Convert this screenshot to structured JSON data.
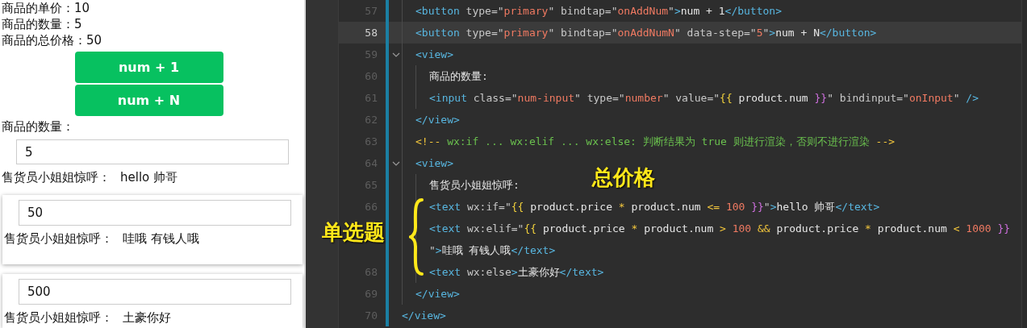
{
  "preview": {
    "info": [
      "商品的单价：10",
      "商品的数量：5",
      "商品的总价格：50"
    ],
    "buttons": [
      "num + 1",
      "num + N"
    ],
    "quantity_label": "商品的数量：",
    "quantity_input": {
      "value": "5"
    },
    "greeting": {
      "label": "售货员小姐姐惊呼：",
      "message": "hello 帅哥"
    },
    "cards": [
      {
        "input": {
          "value": "50"
        },
        "greeting": {
          "label": "售货员小姐姐惊呼：",
          "message": "哇哦 有钱人哦"
        }
      },
      {
        "input": {
          "value": "500"
        },
        "greeting": {
          "label": "售货员小姐姐惊呼：",
          "message": "土豪你好"
        }
      }
    ]
  },
  "editor": {
    "lines": [
      {
        "children": [
          {
            "number": "57",
            "fold": false,
            "current": false,
            "tokens": [
              {
                "kind": "tag",
                "text": "<button"
              },
              {
                "kind": "attr",
                "text": " type=\""
              },
              {
                "kind": "str",
                "text": "primary"
              },
              {
                "kind": "attr",
                "text": "\" bindtap=\""
              },
              {
                "kind": "str",
                "text": "onAddNum"
              },
              {
                "kind": "attr",
                "text": "\""
              },
              {
                "kind": "tag",
                "text": ">"
              },
              {
                "kind": "text",
                "text": "num + 1"
              },
              {
                "kind": "tag",
                "text": "</button>"
              }
            ]
          },
          {
            "number": "58",
            "fold": false,
            "current": true,
            "tokens": [
              {
                "kind": "tag",
                "text": "<button"
              },
              {
                "kind": "attr",
                "text": " type=\""
              },
              {
                "kind": "str",
                "text": "primary"
              },
              {
                "kind": "attr",
                "text": "\" bindtap=\""
              },
              {
                "kind": "str",
                "text": "onAddNumN"
              },
              {
                "kind": "attr",
                "text": "\" data-step=\""
              },
              {
                "kind": "str",
                "text": "5"
              },
              {
                "kind": "attr",
                "text": "\""
              },
              {
                "kind": "tag",
                "text": ">"
              },
              {
                "kind": "text",
                "text": "num + N"
              },
              {
                "kind": "tag",
                "text": "</button>"
              }
            ]
          },
          {
            "number": "59",
            "fold": true,
            "current": false,
            "tokens": [
              {
                "kind": "tag",
                "text": "<view>"
              }
            ],
            "children": [
              {
                "number": "60",
                "fold": false,
                "current": false,
                "tokens": [
                  {
                    "kind": "text",
                    "text": "商品的数量:"
                  }
                ]
              },
              {
                "number": "61",
                "fold": false,
                "current": false,
                "tokens": [
                  {
                    "kind": "tag",
                    "text": "<input"
                  },
                  {
                    "kind": "attr",
                    "text": " class=\""
                  },
                  {
                    "kind": "str",
                    "text": "num-input"
                  },
                  {
                    "kind": "attr",
                    "text": "\" type=\""
                  },
                  {
                    "kind": "str",
                    "text": "number"
                  },
                  {
                    "kind": "attr",
                    "text": "\" value=\""
                  },
                  {
                    "kind": "brace",
                    "text": "{{"
                  },
                  {
                    "kind": "text",
                    "text": " product.num "
                  },
                  {
                    "kind": "brace2",
                    "text": "}}"
                  },
                  {
                    "kind": "attr",
                    "text": "\" bindinput=\""
                  },
                  {
                    "kind": "str",
                    "text": "onInput"
                  },
                  {
                    "kind": "attr",
                    "text": "\" "
                  },
                  {
                    "kind": "tag",
                    "text": "/>"
                  }
                ]
              }
            ]
          },
          {
            "number": "62",
            "fold": false,
            "current": false,
            "tokens": [
              {
                "kind": "tag",
                "text": "</view>"
              }
            ]
          },
          {
            "number": "63",
            "fold": false,
            "current": false,
            "tokens": [
              {
                "kind": "op",
                "text": "<!--"
              },
              {
                "kind": "comment",
                "text": " wx:if ... wx:elif ... wx:else: 判断结果为 true 则进行渲染，否则不进行渲染 "
              },
              {
                "kind": "op",
                "text": "-->"
              }
            ]
          },
          {
            "number": "64",
            "fold": true,
            "current": false,
            "tokens": [
              {
                "kind": "tag",
                "text": "<view>"
              }
            ],
            "children": [
              {
                "number": "65",
                "fold": false,
                "current": false,
                "tokens": [
                  {
                    "kind": "text",
                    "text": "售货员小姐姐惊呼:"
                  }
                ]
              },
              {
                "number": "66",
                "fold": false,
                "current": false,
                "tokens": [
                  {
                    "kind": "tag",
                    "text": "<text"
                  },
                  {
                    "kind": "attr",
                    "text": " wx:if=\""
                  },
                  {
                    "kind": "brace",
                    "text": "{{"
                  },
                  {
                    "kind": "text",
                    "text": " product.price "
                  },
                  {
                    "kind": "op",
                    "text": "*"
                  },
                  {
                    "kind": "text",
                    "text": " product.num "
                  },
                  {
                    "kind": "op",
                    "text": "<="
                  },
                  {
                    "kind": "str",
                    "text": " 100 "
                  },
                  {
                    "kind": "brace2",
                    "text": "}}"
                  },
                  {
                    "kind": "attr",
                    "text": "\""
                  },
                  {
                    "kind": "tag",
                    "text": ">"
                  },
                  {
                    "kind": "text",
                    "text": "hello 帅哥"
                  },
                  {
                    "kind": "tag",
                    "text": "</text>"
                  }
                ]
              },
              {
                "fold": false,
                "current": false,
                "tokens": [
                  {
                    "kind": "tag",
                    "text": "<text"
                  },
                  {
                    "kind": "attr",
                    "text": " wx:elif=\""
                  },
                  {
                    "kind": "brace",
                    "text": "{{"
                  },
                  {
                    "kind": "text",
                    "text": " product.price "
                  },
                  {
                    "kind": "op",
                    "text": "*"
                  },
                  {
                    "kind": "text",
                    "text": " product.num "
                  },
                  {
                    "kind": "op",
                    "text": ">"
                  },
                  {
                    "kind": "str",
                    "text": " 100 "
                  },
                  {
                    "kind": "op",
                    "text": "&&"
                  },
                  {
                    "kind": "text",
                    "text": " product.price "
                  },
                  {
                    "kind": "op",
                    "text": "*"
                  },
                  {
                    "kind": "text",
                    "text": " product.num "
                  },
                  {
                    "kind": "op",
                    "text": "<"
                  },
                  {
                    "kind": "str",
                    "text": " 1000 "
                  },
                  {
                    "kind": "brace2",
                    "text": "}}"
                  }
                ]
              },
              {
                "fold": false,
                "current": false,
                "tokens": [
                  {
                    "kind": "attr",
                    "text": "\""
                  },
                  {
                    "kind": "tag",
                    "text": ">"
                  },
                  {
                    "kind": "text",
                    "text": "哇哦 有钱人哦"
                  },
                  {
                    "kind": "tag",
                    "text": "</text>"
                  }
                ]
              },
              {
                "number": "68",
                "fold": false,
                "current": false,
                "tokens": [
                  {
                    "kind": "tag",
                    "text": "<text"
                  },
                  {
                    "kind": "attr",
                    "text": " wx:else"
                  },
                  {
                    "kind": "tag",
                    "text": ">"
                  },
                  {
                    "kind": "text",
                    "text": "土豪你好"
                  },
                  {
                    "kind": "tag",
                    "text": "</text>"
                  }
                ]
              }
            ]
          },
          {
            "number": "69",
            "fold": false,
            "current": false,
            "tokens": [
              {
                "kind": "tag",
                "text": "</view>"
              }
            ]
          }
        ]
      },
      {
        "number": "70",
        "fold": false,
        "current": false,
        "tokens": [
          {
            "kind": "tag",
            "text": "</view>"
          }
        ]
      }
    ]
  },
  "annotations": [
    {
      "kind": "heading",
      "text": "总价格"
    },
    {
      "kind": "side",
      "text": "单选题"
    },
    {
      "kind": "brace"
    }
  ]
}
